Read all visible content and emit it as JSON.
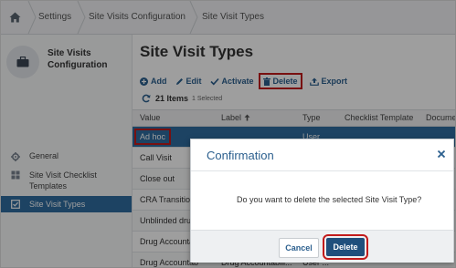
{
  "breadcrumb": [
    "Settings",
    "Site Visits Configuration",
    "Site Visit Types"
  ],
  "sidebar": {
    "title": "Site Visits Configuration",
    "items": [
      {
        "label": "General",
        "icon": "gear-icon"
      },
      {
        "label": "Site Visit Checklist Templates",
        "icon": "grid-icon"
      },
      {
        "label": "Site Visit Types",
        "icon": "checkbox-icon",
        "active": true
      }
    ]
  },
  "main": {
    "title": "Site Visit Types",
    "toolbar": {
      "add": "Add",
      "edit": "Edit",
      "activate": "Activate",
      "delete": "Delete",
      "export": "Export"
    },
    "count_label": "21 Items",
    "selected_label": "1 Selected",
    "columns": [
      "Value",
      "Label",
      "Type",
      "Checklist Template",
      "Docume"
    ],
    "rows": [
      {
        "value": "Ad hoc",
        "label": "",
        "type": "User ...",
        "selected": true
      },
      {
        "value": "Call Visit",
        "label": "",
        "type": ""
      },
      {
        "value": "Close out",
        "label": "",
        "type": ""
      },
      {
        "value": "CRA Transition",
        "label": "",
        "type": ""
      },
      {
        "value": "Unblinded drug",
        "label": "",
        "type": ""
      },
      {
        "value": "Drug Accountab",
        "label": "",
        "type": ""
      },
      {
        "value": "Drug Accountab",
        "label": "Drug Accountabili...",
        "type": "User ..."
      }
    ]
  },
  "dialog": {
    "title": "Confirmation",
    "message": "Do you want to delete the selected Site Visit Type?",
    "cancel": "Cancel",
    "confirm": "Delete"
  },
  "colors": {
    "accent": "#2f6da1",
    "highlight": "#c21b1b",
    "primary_button": "#1f4f7c"
  }
}
